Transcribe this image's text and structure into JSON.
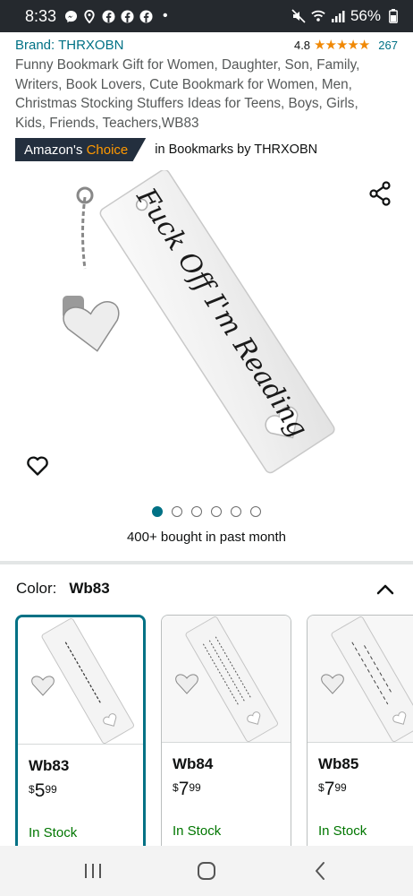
{
  "status_bar": {
    "time": "8:33",
    "battery": "56%",
    "left_icons": [
      "messenger-icon",
      "location-icon",
      "facebook-icon",
      "facebook-icon",
      "facebook-icon"
    ],
    "dot": "•"
  },
  "product": {
    "brand": "Brand: THRXOBN",
    "rating_value": "4.8",
    "stars": "★★★★★",
    "rating_count": "267",
    "title": "Funny Bookmark Gift for Women, Daughter, Son, Family, Writers, Book Lovers, Cute Bookmark for Women, Men, Christmas Stocking Stuffers Ideas for Teens, Boys, Girls, Kids, Friends, Teachers,WB83",
    "badge_prefix": "Amazon's",
    "badge_suffix": "Choice",
    "badge_category": "in Bookmarks by THRXOBN",
    "image_text": "Fuck Off I'm Reading",
    "image_count": 6,
    "active_image": 1,
    "bought_text": "400+ bought in past month"
  },
  "color_selector": {
    "label": "Color:",
    "selected": "Wb83"
  },
  "variants": [
    {
      "name": "Wb83",
      "currency": "$",
      "whole": "5",
      "fraction": "99",
      "stock": "In Stock",
      "selected": true
    },
    {
      "name": "Wb84",
      "currency": "$",
      "whole": "7",
      "fraction": "99",
      "stock": "In Stock",
      "selected": false
    },
    {
      "name": "Wb85",
      "currency": "$",
      "whole": "7",
      "fraction": "99",
      "stock": "In Stock",
      "selected": false
    }
  ],
  "colors": {
    "link": "#007185",
    "star": "#f08804",
    "badge_bg": "#232f3e",
    "badge_accent": "#ff9900",
    "in_stock": "#007600"
  }
}
